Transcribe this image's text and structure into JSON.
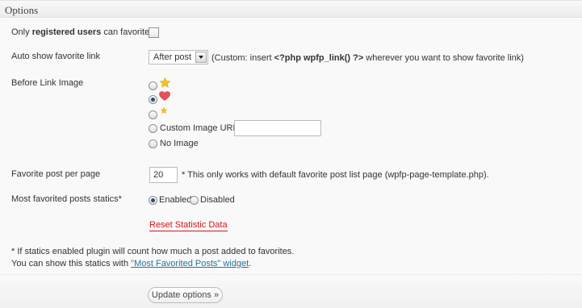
{
  "header": {
    "title": "Options"
  },
  "rows": {
    "registered": {
      "label_pre": "Only ",
      "label_bold": "registered users",
      "label_post": " can favorite"
    },
    "auto_show": {
      "label": "Auto show favorite link",
      "selected": "After post",
      "note_pre": "(Custom: insert ",
      "note_code": "<?php wpfp_link() ?>",
      "note_post": " wherever you want to show favorite link)"
    },
    "before_image": {
      "label": "Before Link Image",
      "options": [
        "star-icon",
        "heart-icon",
        "small-star-icon",
        "Custom Image URL :",
        "No Image"
      ],
      "custom_url_value": ""
    },
    "per_page": {
      "label": "Favorite post per page",
      "value": "20",
      "note": "* This only works with default favorite post list page (wpfp-page-template.php)."
    },
    "statics": {
      "label": "Most favorited posts statics*",
      "enabled": "Enabled",
      "disabled": "Disabled"
    },
    "reset": "Reset Statistic Data"
  },
  "footnote": {
    "line1": "* If statics enabled plugin will count how much a post added to favorites.",
    "line2_pre": "You can show this statics with ",
    "line2_link": "\"Most Favorited Posts\" widget",
    "line2_post": "."
  },
  "update_button": "Update options »",
  "colors": {
    "link": "#21759b",
    "reset": "#d6141a",
    "star": "#f5c518",
    "heart": "#e8505b"
  }
}
